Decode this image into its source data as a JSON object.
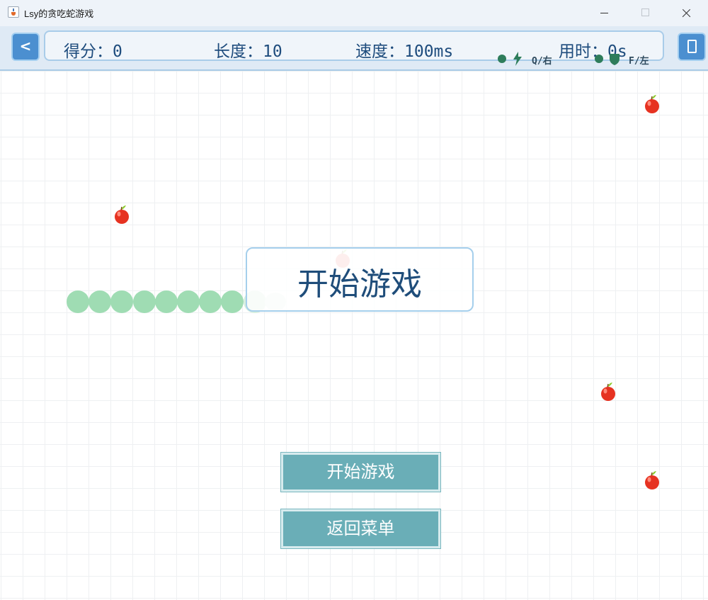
{
  "window": {
    "title": "Lsy的贪吃蛇游戏",
    "icon": "java-cup-icon"
  },
  "hud": {
    "back_label": "<",
    "score": "得分：0",
    "length": "长度：10",
    "speed": "速度：100ms",
    "time": "用时：0s",
    "hints": [
      {
        "icon": "lightning-icon",
        "text": "Q/右"
      },
      {
        "icon": "shield-icon",
        "text": "F/左"
      }
    ]
  },
  "game": {
    "apples": 5,
    "snake_length": 10,
    "title": "开始游戏",
    "buttons": {
      "start": "开始游戏",
      "menu": "返回菜单"
    }
  },
  "colors": {
    "snake": "#9fdcb3",
    "button": "#6aaeb7",
    "hud_text": "#1e4c7d",
    "apple": "#e63221"
  }
}
